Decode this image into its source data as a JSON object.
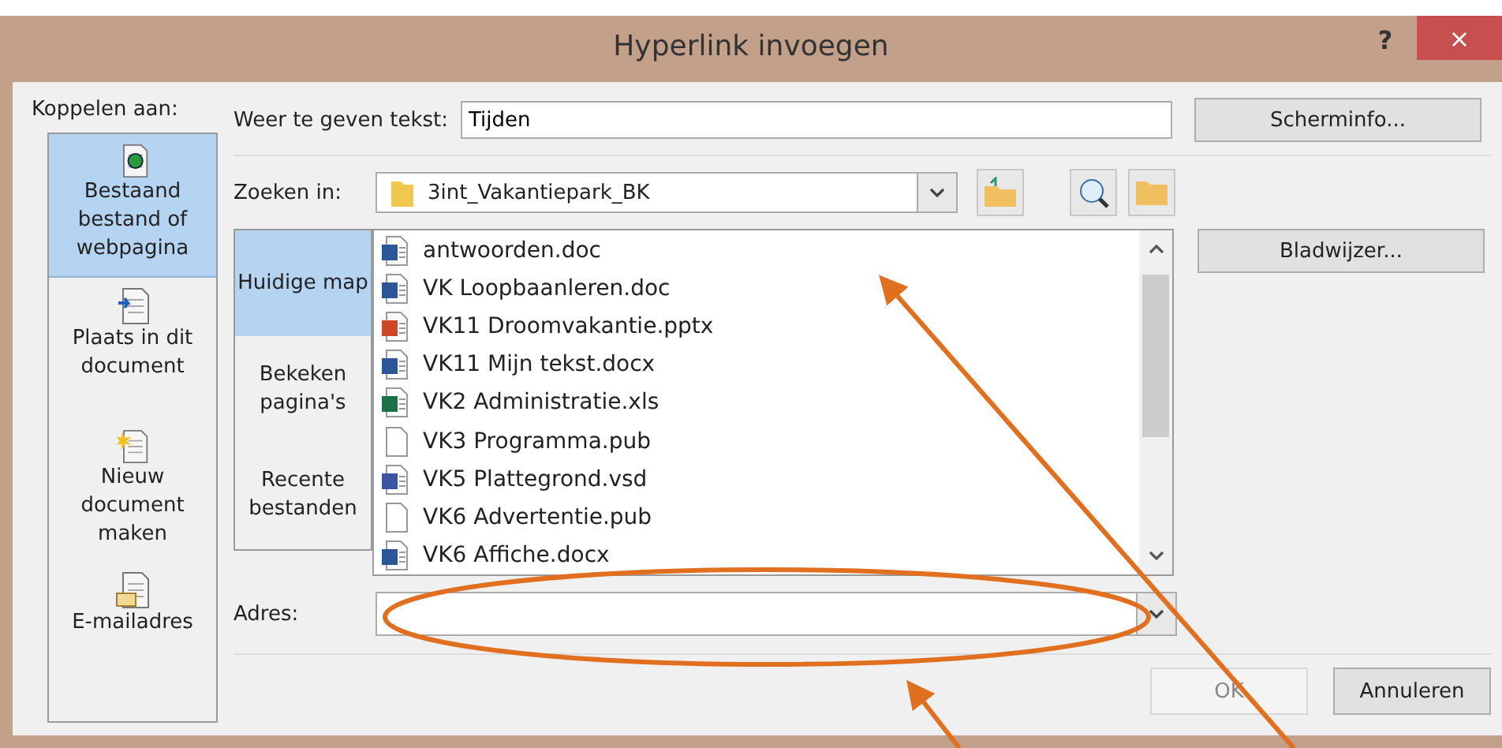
{
  "window": {
    "title": "Hyperlink invoegen",
    "help": "?",
    "close": "×"
  },
  "link_to": {
    "label": "Koppelen aan:",
    "items": [
      {
        "label": "Bestaand bestand of webpagina",
        "kind": "file",
        "selected": true
      },
      {
        "label": "Plaats in dit document",
        "kind": "place",
        "selected": false
      },
      {
        "label": "Nieuw document maken",
        "kind": "new",
        "selected": false
      },
      {
        "label": "E-mailadres",
        "kind": "mail",
        "selected": false
      }
    ]
  },
  "display_text": {
    "label": "Weer te geven tekst:",
    "value": "Tijden"
  },
  "screen_tip_button": "Scherminfo...",
  "look_in": {
    "label": "Zoeken in:",
    "value": "3int_Vakantiepark_BK"
  },
  "bookmark_button": "Bladwijzer...",
  "views": [
    {
      "label": "Huidige map",
      "selected": true
    },
    {
      "label": "Bekeken pagina's",
      "selected": false
    },
    {
      "label": "Recente bestanden",
      "selected": false
    }
  ],
  "files": [
    {
      "name": "antwoorden.doc",
      "kind": "word"
    },
    {
      "name": "VK Loopbaanleren.doc",
      "kind": "word"
    },
    {
      "name": "VK11 Droomvakantie.pptx",
      "kind": "powerpoint"
    },
    {
      "name": "VK11 Mijn tekst.docx",
      "kind": "word"
    },
    {
      "name": "VK2 Administratie.xls",
      "kind": "excel"
    },
    {
      "name": "VK3 Programma.pub",
      "kind": "blank"
    },
    {
      "name": "VK5 Plattegrond.vsd",
      "kind": "visio"
    },
    {
      "name": "VK6 Advertentie.pub",
      "kind": "blank"
    },
    {
      "name": "VK6 Affiche.docx",
      "kind": "word"
    }
  ],
  "address": {
    "label": "Adres:"
  },
  "buttons": [
    {
      "label": "OK",
      "disabled": true
    },
    {
      "label": "Annuleren",
      "disabled": false
    }
  ]
}
